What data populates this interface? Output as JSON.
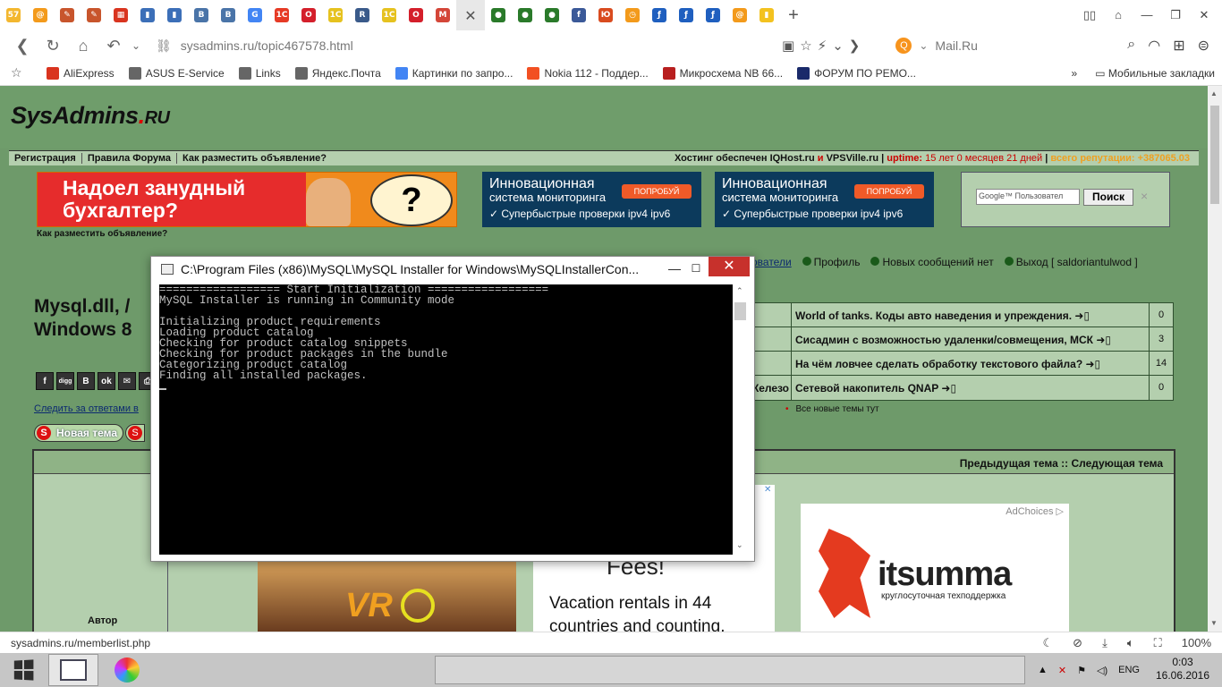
{
  "browser": {
    "tabs": [
      {
        "label": "57",
        "color": "#f3b72f"
      },
      {
        "label": "@",
        "color": "#f39a1b"
      },
      {
        "label": "✎",
        "color": "#c8552c"
      },
      {
        "label": "✎",
        "color": "#c8552c"
      },
      {
        "label": "▦",
        "color": "#d9341f"
      },
      {
        "label": "▮",
        "color": "#3c6fb8"
      },
      {
        "label": "▮",
        "color": "#3c6fb8"
      },
      {
        "label": "B",
        "color": "#4a74a8"
      },
      {
        "label": "B",
        "color": "#4a74a8"
      },
      {
        "label": "G",
        "color": "#4285f4"
      },
      {
        "label": "1C",
        "color": "#e63a25"
      },
      {
        "label": "O",
        "color": "#d41f2b"
      },
      {
        "label": "1C",
        "color": "#e6c21f"
      },
      {
        "label": "R",
        "color": "#3a5a8a"
      },
      {
        "label": "1C",
        "color": "#e6c21f"
      },
      {
        "label": "O",
        "color": "#d41f2b"
      },
      {
        "label": "M",
        "color": "#d44638"
      },
      {
        "label": "✕",
        "color": "#666",
        "active": true
      },
      {
        "label": "●",
        "color": "#2a7a2a"
      },
      {
        "label": "●",
        "color": "#2a7a2a"
      },
      {
        "label": "●",
        "color": "#2a7a2a"
      },
      {
        "label": "f",
        "color": "#3b5998"
      },
      {
        "label": "Ю",
        "color": "#d94b1f"
      },
      {
        "label": "◷",
        "color": "#f39a1b"
      },
      {
        "label": "ƒ",
        "color": "#1f5fbf"
      },
      {
        "label": "ƒ",
        "color": "#1f5fbf"
      },
      {
        "label": "ƒ",
        "color": "#1f5fbf"
      },
      {
        "label": "@",
        "color": "#f39a1b"
      },
      {
        "label": "▮",
        "color": "#f3c21f"
      }
    ],
    "url": "sysadmins.ru/topic467578.html",
    "search_engine": "Mail.Ru",
    "bookmarks": [
      {
        "label": "AliExpress",
        "color": "#d9341f"
      },
      {
        "label": "ASUS E-Service",
        "color": "#666"
      },
      {
        "label": "Links",
        "color": "#666"
      },
      {
        "label": "Яндекс.Почта",
        "color": "#666"
      },
      {
        "label": "Картинки по запро...",
        "color": "#4285f4"
      },
      {
        "label": "Nokia 112 - Поддер...",
        "color": "#f25022"
      },
      {
        "label": "Микросхема NB 66...",
        "color": "#b81f1f"
      },
      {
        "label": "ФОРУМ ПО РЕМО...",
        "color": "#1a2a6a"
      }
    ],
    "mobile_bookmarks": "Мобильные закладки",
    "status_url": "sysadmins.ru/memberlist.php",
    "zoom": "100%"
  },
  "site": {
    "logo_main": "SysAdmins",
    "logo_dot": ".",
    "logo_ru": "RU",
    "nav": [
      "Регистрация",
      "Правила Форума",
      "Как разместить объявление?"
    ],
    "host_label": "Хостинг обеспечен",
    "host_a": "IQHost.ru",
    "host_and": "и",
    "host_b": "VPSVille.ru",
    "uptime_label": "uptime:",
    "uptime_value": "15 лет 0 месяцев 21 дней",
    "rep_label": "всего репутации: +387065.03",
    "banner1_text": "Надоел занудный бухгалтер?",
    "banner1_q": "?",
    "banner2": {
      "line1": "Инновационная",
      "line2": "система мониторинга",
      "btn": "ПОПРОБУЙ",
      "line3": "✓  Супербыстрые проверки ipv4 ipv6"
    },
    "search_placeholder": "Google™ Пользовател",
    "search_button": "Поиск",
    "search_close": "×",
    "howto": "Как разместить объявление?",
    "userbar": {
      "users": "ователи",
      "profile": "Профиль",
      "messages": "Новых сообщений нет",
      "logout": "Выход [ saldoriantulwod ]"
    },
    "topic_title_line1": "Mysql.dll, /",
    "topic_title_line2": "Windows 8",
    "social": [
      "f",
      "digg",
      "B",
      "ok",
      "✉",
      "⎙"
    ],
    "follow_link": "Следить за ответами в",
    "new_topic": "Новая тема",
    "latest_topics": [
      {
        "left": "",
        "title": "World of tanks. Коды авто наведения и упреждения. ➜▯",
        "count": "0"
      },
      {
        "left": "",
        "title": "Сисадмин с возможностью удаленки/совмещения, МСК ➜▯",
        "count": "3"
      },
      {
        "left": "",
        "title": "На чём ловчее сделать обработку текстового файла? ➜▯",
        "count": "14"
      },
      {
        "left": "Железо",
        "title": "Сетевой накопитель QNAP ➜▯",
        "count": "0"
      }
    ],
    "all_new": "Все новые темы тут",
    "prevnext": "Предыдущая тема :: Следующая тема",
    "author": "Автор",
    "ad_vr": {
      "logo": "VR"
    },
    "ad_text": {
      "fees": "Fees!",
      "body_1": "Vacation rentals in 44",
      "body_2": "countries and counting."
    },
    "ad_its": {
      "adchoices": "AdChoices ▷",
      "name": "itsumma",
      "sub": "круглосуточная техподдержка"
    }
  },
  "console": {
    "title": "C:\\Program Files (x86)\\MySQL\\MySQL Installer for Windows\\MySQLInstallerCon...",
    "min": "—",
    "max": "☐",
    "close": "✕",
    "lines": [
      "================== Start Initialization ==================",
      "MySQL Installer is running in Community mode",
      "",
      "Initializing product requirements",
      "Loading product catalog",
      "Checking for product catalog snippets",
      "Checking for product packages in the bundle",
      "Categorizing product catalog",
      "Finding all installed packages."
    ]
  },
  "taskbar": {
    "lang": "ENG",
    "time": "0:03",
    "date": "16.06.2016"
  }
}
